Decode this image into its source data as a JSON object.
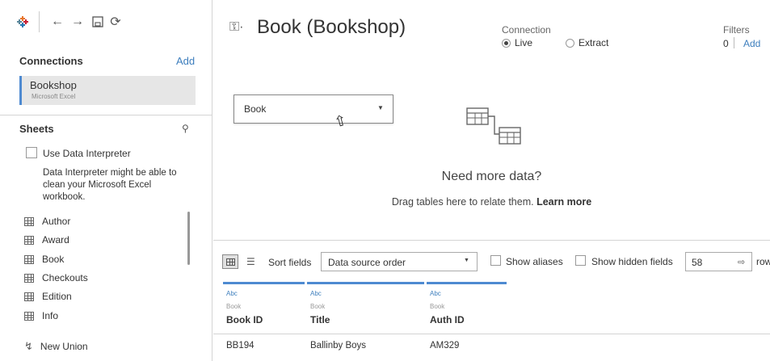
{
  "left": {
    "connections": {
      "title": "Connections",
      "add_label": "Add",
      "items": [
        {
          "name": "Bookshop",
          "type": "Microsoft Excel"
        }
      ]
    },
    "sheets": {
      "title": "Sheets",
      "interpreter_label": "Use Data Interpreter",
      "interpreter_checked": false,
      "interpreter_desc": "Data Interpreter might be able to clean your Microsoft Excel workbook.",
      "items": [
        {
          "label": "Author"
        },
        {
          "label": "Award"
        },
        {
          "label": "Book"
        },
        {
          "label": "Checkouts"
        },
        {
          "label": "Edition"
        },
        {
          "label": "Info"
        }
      ],
      "new_union_label": "New Union"
    }
  },
  "header": {
    "title": "Book (Bookshop)",
    "connection_label": "Connection",
    "connection_options": [
      {
        "label": "Live",
        "selected": true
      },
      {
        "label": "Extract",
        "selected": false
      }
    ],
    "filters_label": "Filters",
    "filters_count": "0",
    "filters_add": "Add"
  },
  "canvas": {
    "table_selected": "Book",
    "need_more_title": "Need more data?",
    "drag_text": "Drag tables here to relate them.",
    "learn_more": "Learn more"
  },
  "grid_toolbar": {
    "sort_label": "Sort fields",
    "sort_value": "Data source order",
    "show_aliases_label": "Show aliases",
    "show_hidden_label": "Show hidden fields",
    "rows_value": "58",
    "rows_label": "rows"
  },
  "grid": {
    "columns": [
      {
        "type": "Abc",
        "source": "Book",
        "name": "Book ID",
        "value": "BB194"
      },
      {
        "type": "Abc",
        "source": "Book",
        "name": "Title",
        "value": "Ballinby Boys"
      },
      {
        "type": "Abc",
        "source": "Book",
        "name": "Auth ID",
        "value": "AM329"
      }
    ]
  },
  "colors": {
    "accent": "#4e8ad1",
    "link": "#3d7ebd",
    "selected_bg": "#e6e6e6"
  }
}
